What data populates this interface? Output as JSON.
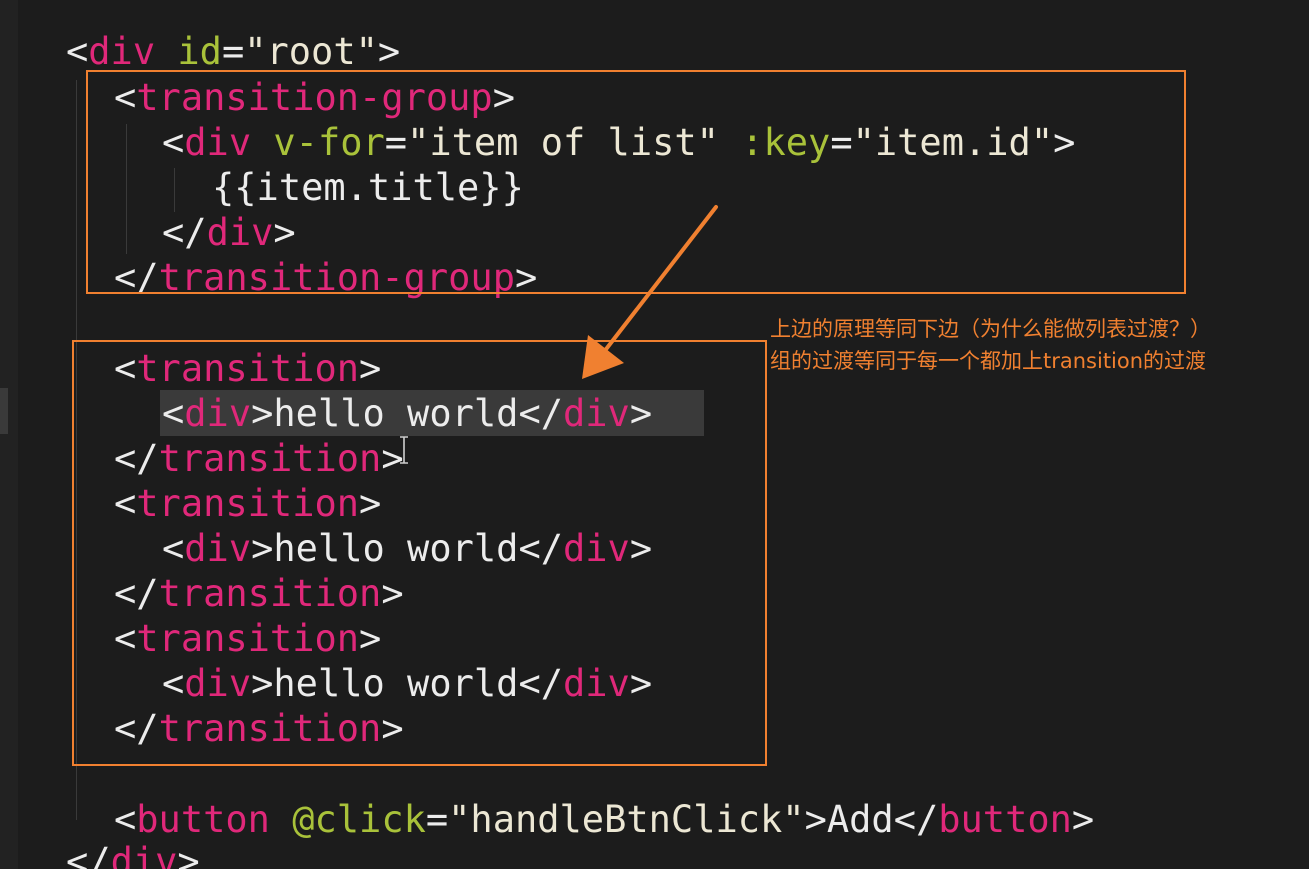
{
  "colors": {
    "background": "#1c1c1c",
    "tag": "#e0287a",
    "attribute": "#a9c23a",
    "punctuation": "#ececec",
    "string": "#ece7d4",
    "annotation": "#f08030",
    "selection": "#3a3a3a"
  },
  "code": {
    "root_open": {
      "lt": "<",
      "tag": "div",
      "attr": "id",
      "eq": "=",
      "value": "\"root\"",
      "gt": ">"
    },
    "tg_open": {
      "lt": "<",
      "tag": "transition-group",
      "gt": ">"
    },
    "vfor_div_open": {
      "lt": "<",
      "tag": "div",
      "attr1": "v-for",
      "eq1": "=",
      "value1": "\"item of list\"",
      "attr2": ":key",
      "eq2": "=",
      "value2": "\"item.id\"",
      "gt": ">"
    },
    "interp": "{{item.title}}",
    "vfor_div_close": {
      "lt": "</",
      "tag": "div",
      "gt": ">"
    },
    "tg_close": {
      "lt": "</",
      "tag": "transition-group",
      "gt": ">"
    },
    "transitions": [
      {
        "open": {
          "lt": "<",
          "tag": "transition",
          "gt": ">"
        },
        "child": {
          "lt": "<",
          "tag": "div",
          "gt": ">",
          "text": "hello world",
          "lt2": "</",
          "tag2": "div",
          "gt2": ">"
        },
        "close": {
          "lt": "</",
          "tag": "transition",
          "gt": ">"
        }
      },
      {
        "open": {
          "lt": "<",
          "tag": "transition",
          "gt": ">"
        },
        "child": {
          "lt": "<",
          "tag": "div",
          "gt": ">",
          "text": "hello world",
          "lt2": "</",
          "tag2": "div",
          "gt2": ">"
        },
        "close": {
          "lt": "</",
          "tag": "transition",
          "gt": ">"
        }
      },
      {
        "open": {
          "lt": "<",
          "tag": "transition",
          "gt": ">"
        },
        "child": {
          "lt": "<",
          "tag": "div",
          "gt": ">",
          "text": "hello world",
          "lt2": "</",
          "tag2": "div",
          "gt2": ">"
        },
        "close": {
          "lt": "</",
          "tag": "transition",
          "gt": ">"
        }
      }
    ],
    "button_line": {
      "lt": "<",
      "tag": "button",
      "attr": "@click",
      "eq": "=",
      "value": "\"handleBtnClick\"",
      "gt": ">",
      "text": "Add",
      "lt2": "</",
      "tag2": "button",
      "gt2": ">"
    },
    "root_close": {
      "lt": "</",
      "tag": "div",
      "gt": ">"
    }
  },
  "annotation": {
    "line1": "上边的原理等同下边（为什么能做列表过渡？）",
    "line2": "组的过渡等同于每一个都加上transition的过渡"
  }
}
